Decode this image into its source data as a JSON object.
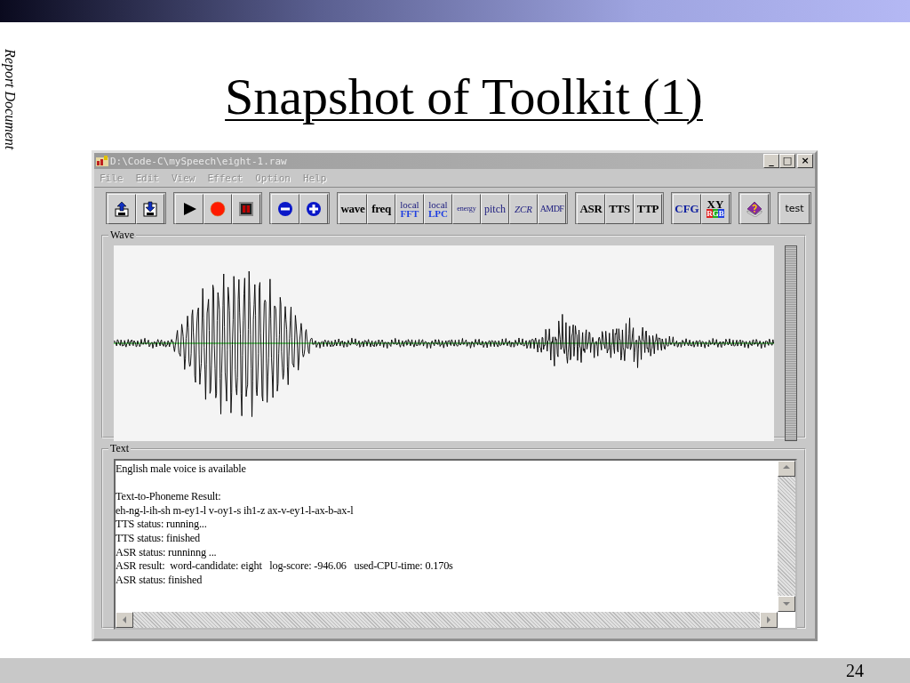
{
  "slide": {
    "side_label": "Report Document",
    "title": "Snapshot of Toolkit (1)",
    "page_number": "24"
  },
  "window": {
    "title": "D:\\Code-C\\mySpeech\\eight-1.raw",
    "controls": [
      "_",
      "□",
      "×"
    ]
  },
  "menu": [
    "File",
    "Edit",
    "View",
    "Effect",
    "Option",
    "Help"
  ],
  "toolbar": [
    [
      {
        "kind": "icon"
      },
      {
        "kind": "icon"
      }
    ],
    [
      {
        "kind": "icon"
      },
      {
        "kind": "icon"
      },
      {
        "kind": "icon"
      }
    ],
    [
      {
        "kind": "icon"
      },
      {
        "kind": "icon"
      }
    ],
    [
      {
        "kind": "text",
        "lines": [
          "wave"
        ]
      },
      {
        "kind": "text",
        "lines": [
          "freq"
        ]
      },
      {
        "kind": "text",
        "lines": [
          "local",
          "FFT"
        ]
      },
      {
        "kind": "text",
        "lines": [
          "local",
          "LPC"
        ]
      },
      {
        "kind": "text",
        "lines": [
          "energy"
        ]
      },
      {
        "kind": "text",
        "lines": [
          "pitch"
        ]
      },
      {
        "kind": "text",
        "lines": [
          "ZCR"
        ]
      },
      {
        "kind": "text",
        "lines": [
          "AMDF"
        ]
      }
    ],
    [
      {
        "kind": "text",
        "lines": [
          "ASR"
        ]
      },
      {
        "kind": "text",
        "lines": [
          "TTS"
        ]
      },
      {
        "kind": "text",
        "lines": [
          "TTP"
        ]
      }
    ],
    [
      {
        "kind": "text",
        "lines": [
          "CFG"
        ]
      },
      {
        "kind": "text",
        "lines": [
          "XY",
          "RGB"
        ]
      }
    ],
    [
      {
        "kind": "icon"
      }
    ],
    [
      {
        "kind": "text",
        "lines": [
          "test"
        ]
      }
    ]
  ],
  "wave_panel": {
    "label": "Wave"
  },
  "text_panel": {
    "label": "Text",
    "paragraphs": [
      [
        "English male voice is available"
      ],
      [
        "Text-to-Phoneme Result:",
        "eh-ng-l-ih-sh m-ey1-l v-oy1-s ih1-z ax-v-ey1-l-ax-b-ax-l",
        "TTS status: running...",
        "TTS status: finished",
        "ASR status: runninng ...",
        "ASR result:  word-candidate: eight   log-score: -946.06   used-CPU-time: 0.170s",
        "ASR status: finished"
      ]
    ]
  }
}
